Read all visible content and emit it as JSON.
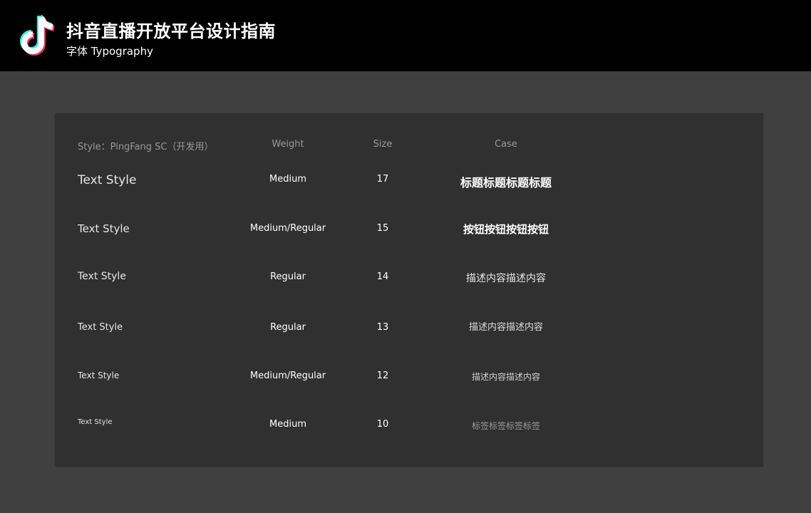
{
  "header": {
    "title": "抖音直播开放平台设计指南",
    "subtitle": "字体 Typography"
  },
  "table": {
    "columns": {
      "style": "Style：PingFang SC（开发用）",
      "weight": "Weight",
      "size": "Size",
      "case": "Case"
    },
    "rows": [
      {
        "style": "Text Style",
        "weight": "Medium",
        "size": "17",
        "case": "标题标题标题标题"
      },
      {
        "style": "Text Style",
        "weight": "Medium/Regular",
        "size": "15",
        "case": "按钮按钮按钮按钮"
      },
      {
        "style": "Text Style",
        "weight": "Regular",
        "size": "14",
        "case": "描述内容描述内容"
      },
      {
        "style": "Text Style",
        "weight": "Regular",
        "size": "13",
        "case": "描述内容描述内容"
      },
      {
        "style": "Text Style",
        "weight": "Medium/Regular",
        "size": "12",
        "case": "描述内容描述内容"
      },
      {
        "style": "Text Style",
        "weight": "Medium",
        "size": "10",
        "case": "标签标签标签标签"
      }
    ]
  },
  "colors": {
    "header_bg": "#000000",
    "page_bg": "#404040",
    "panel_bg": "#303030",
    "logo_cyan": "#25F4EE",
    "logo_red": "#FE2C55"
  }
}
